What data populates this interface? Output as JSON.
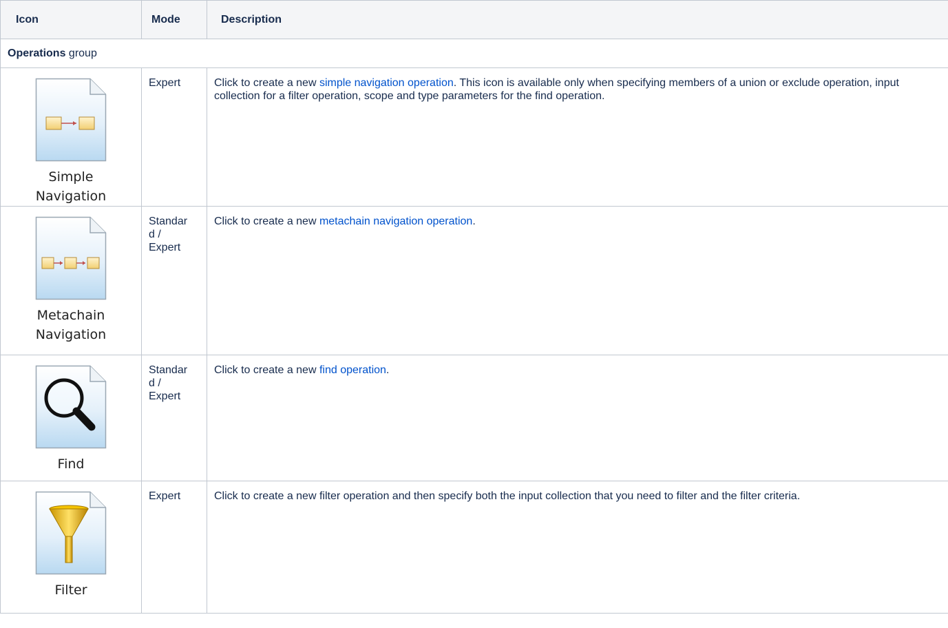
{
  "header": {
    "icon": "Icon",
    "mode": "Mode",
    "description": "Description"
  },
  "group": {
    "name": "Operations",
    "suffix": " group"
  },
  "rows": [
    {
      "icon": "simple-navigation-icon",
      "icon_label": [
        "Simple",
        "Navigation"
      ],
      "mode": "Expert",
      "desc_before": "Click to create a new ",
      "desc_link": "simple navigation operation",
      "desc_after": ". This icon is available only when specifying members of a union or exclude operation, input collection for a filter operation, scope and type parameters for the find operation."
    },
    {
      "icon": "metachain-navigation-icon",
      "icon_label": [
        "Metachain",
        "Navigation"
      ],
      "mode": "Standard / Expert",
      "desc_before": "Click to create a new ",
      "desc_link": "metachain navigation operation",
      "desc_after": "."
    },
    {
      "icon": "find-icon",
      "icon_label": [
        "Find"
      ],
      "mode": "Standard / Expert",
      "desc_before": "Click to create a new ",
      "desc_link": "find operation",
      "desc_after": "."
    },
    {
      "icon": "filter-icon",
      "icon_label": [
        "Filter"
      ],
      "mode": "Expert",
      "desc_before": "Click to create a new filter operation and then specify both the input collection that you need to filter and the filter criteria.",
      "desc_link": "",
      "desc_after": ""
    }
  ]
}
